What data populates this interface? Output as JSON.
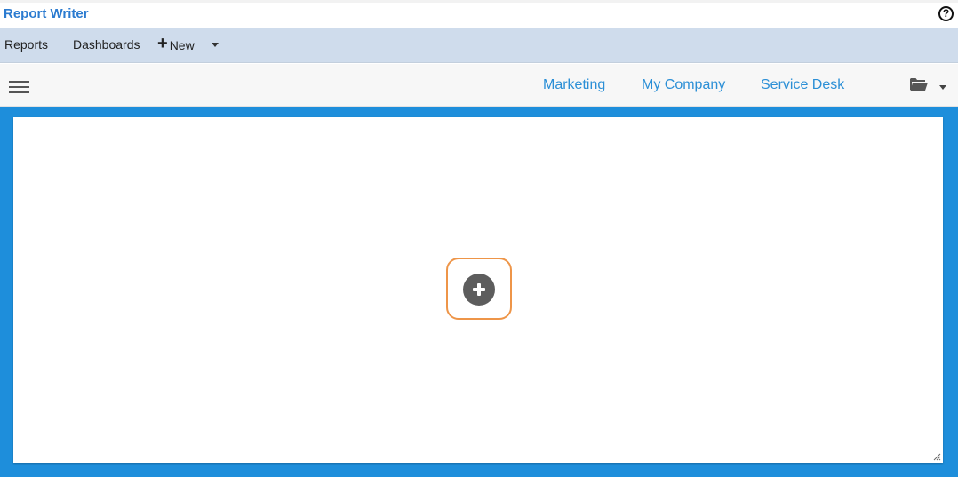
{
  "app": {
    "title": "Report Writer"
  },
  "header": {
    "help_icon": "question-circle-icon",
    "help_glyph": "?"
  },
  "menu": {
    "reports_label": "Reports",
    "dashboards_label": "Dashboards",
    "new_glyph": "+",
    "new_label": "New",
    "new_dropdown_icon": "caret-down-icon"
  },
  "tabs": [
    {
      "label": "Marketing"
    },
    {
      "label": "My Company"
    },
    {
      "label": "Service Desk"
    }
  ],
  "toolbar": {
    "menu_icon": "hamburger-icon",
    "folder_icon": "folder-open-icon",
    "folder_dropdown_icon": "caret-down-icon"
  },
  "canvas": {
    "add_widget_icon": "plus-circle-icon"
  },
  "colors": {
    "accent": "#2b8fd6",
    "title": "#2b7bd0",
    "menu_bar": "#cfdcec",
    "workspace": "#1e8edb",
    "focus_ring": "#ee9548",
    "add_button": "#5d5d5d"
  }
}
